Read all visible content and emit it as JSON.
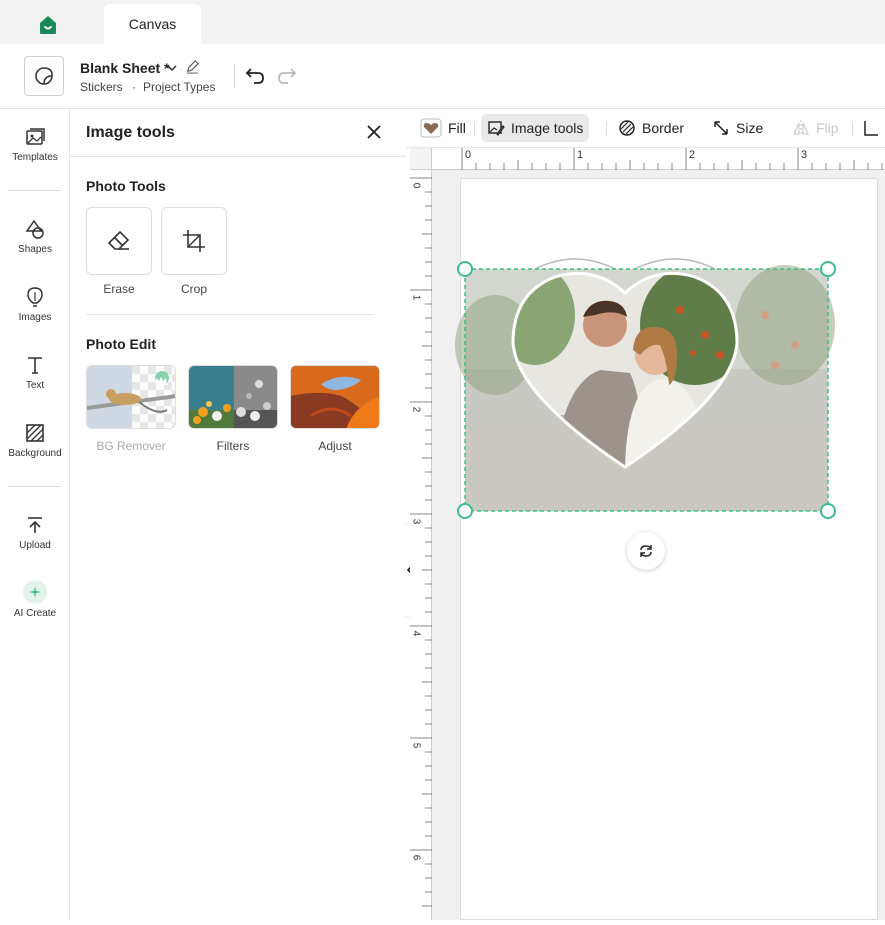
{
  "topbar": {
    "tab_label": "Canvas",
    "home_icon": "home-icon"
  },
  "header": {
    "project_title": "Blank Sheet *",
    "crumb_1": "Stickers",
    "crumb_sep": "·",
    "crumb_2": "Project Types"
  },
  "rail": {
    "items": [
      {
        "label": "Templates",
        "icon": "templates-icon"
      },
      {
        "label": "Shapes",
        "icon": "shapes-icon"
      },
      {
        "label": "Images",
        "icon": "images-icon"
      },
      {
        "label": "Text",
        "icon": "text-icon"
      },
      {
        "label": "Background",
        "icon": "background-icon"
      },
      {
        "label": "Upload",
        "icon": "upload-icon"
      },
      {
        "label": "AI Create",
        "icon": "ai-create-icon"
      }
    ]
  },
  "panel": {
    "title": "Image tools",
    "photo_tools_title": "Photo Tools",
    "tools": [
      {
        "label": "Erase",
        "icon": "eraser-icon"
      },
      {
        "label": "Crop",
        "icon": "crop-icon"
      }
    ],
    "photo_edit_title": "Photo Edit",
    "edits": [
      {
        "label": "BG Remover",
        "disabled": true,
        "premium": true
      },
      {
        "label": "Filters"
      },
      {
        "label": "Adjust"
      }
    ]
  },
  "toolbar": {
    "fill": "Fill",
    "image_tools": "Image tools",
    "border": "Border",
    "size": "Size",
    "flip": "Flip"
  },
  "rulers": {
    "top": [
      "0",
      "1",
      "2",
      "3"
    ],
    "left": [
      "0",
      "1",
      "2",
      "3",
      "4",
      "5",
      "6"
    ]
  },
  "colors": {
    "accent": "#3cbf8a",
    "selection": "#3cbf8a",
    "brand_green": "#1b8a5a"
  }
}
